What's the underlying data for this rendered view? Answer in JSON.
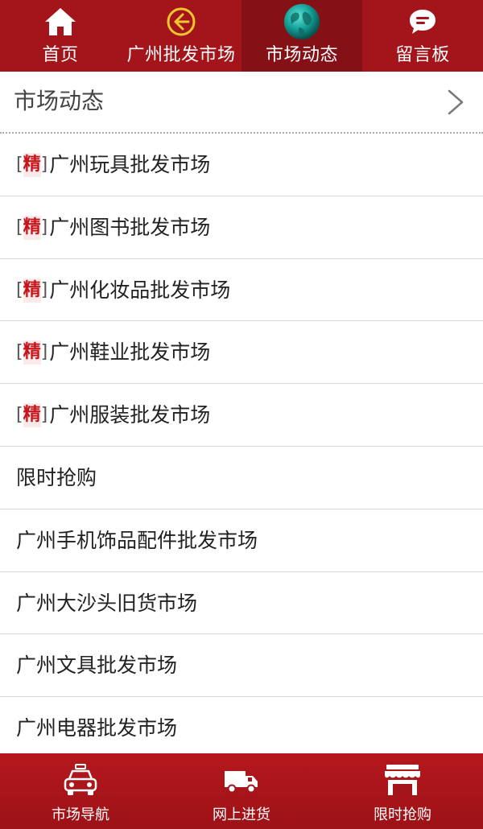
{
  "top_nav": {
    "tabs": [
      {
        "label": "首页",
        "icon": "home-icon",
        "active": false
      },
      {
        "label": "广州批发市场",
        "icon": "back-arrow-circle-icon",
        "active": false
      },
      {
        "label": "市场动态",
        "icon": "globe-icon",
        "active": true
      },
      {
        "label": "留言板",
        "icon": "speech-bubble-icon",
        "active": false
      }
    ],
    "colors": {
      "background": "#a3151a",
      "active_background": "#841116"
    }
  },
  "section": {
    "title": "市场动态",
    "chevron_icon": "chevron-right-icon"
  },
  "list": {
    "badge_text": "精",
    "items": [
      {
        "label": "广州玩具批发市场",
        "featured": true
      },
      {
        "label": "广州图书批发市场",
        "featured": true
      },
      {
        "label": "广州化妆品批发市场",
        "featured": true
      },
      {
        "label": "广州鞋业批发市场",
        "featured": true
      },
      {
        "label": "广州服装批发市场",
        "featured": true
      },
      {
        "label": "限时抢购",
        "featured": false
      },
      {
        "label": "广州手机饰品配件批发市场",
        "featured": false
      },
      {
        "label": "广州大沙头旧货市场",
        "featured": false
      },
      {
        "label": "广州文具批发市场",
        "featured": false
      },
      {
        "label": "广州电器批发市场",
        "featured": false
      }
    ]
  },
  "bottom_nav": {
    "buttons": [
      {
        "label": "市场导航",
        "icon": "taxi-icon"
      },
      {
        "label": "网上进货",
        "icon": "delivery-truck-icon"
      },
      {
        "label": "限时抢购",
        "icon": "storefront-icon"
      }
    ],
    "colors": {
      "background": "#a3151a"
    }
  }
}
